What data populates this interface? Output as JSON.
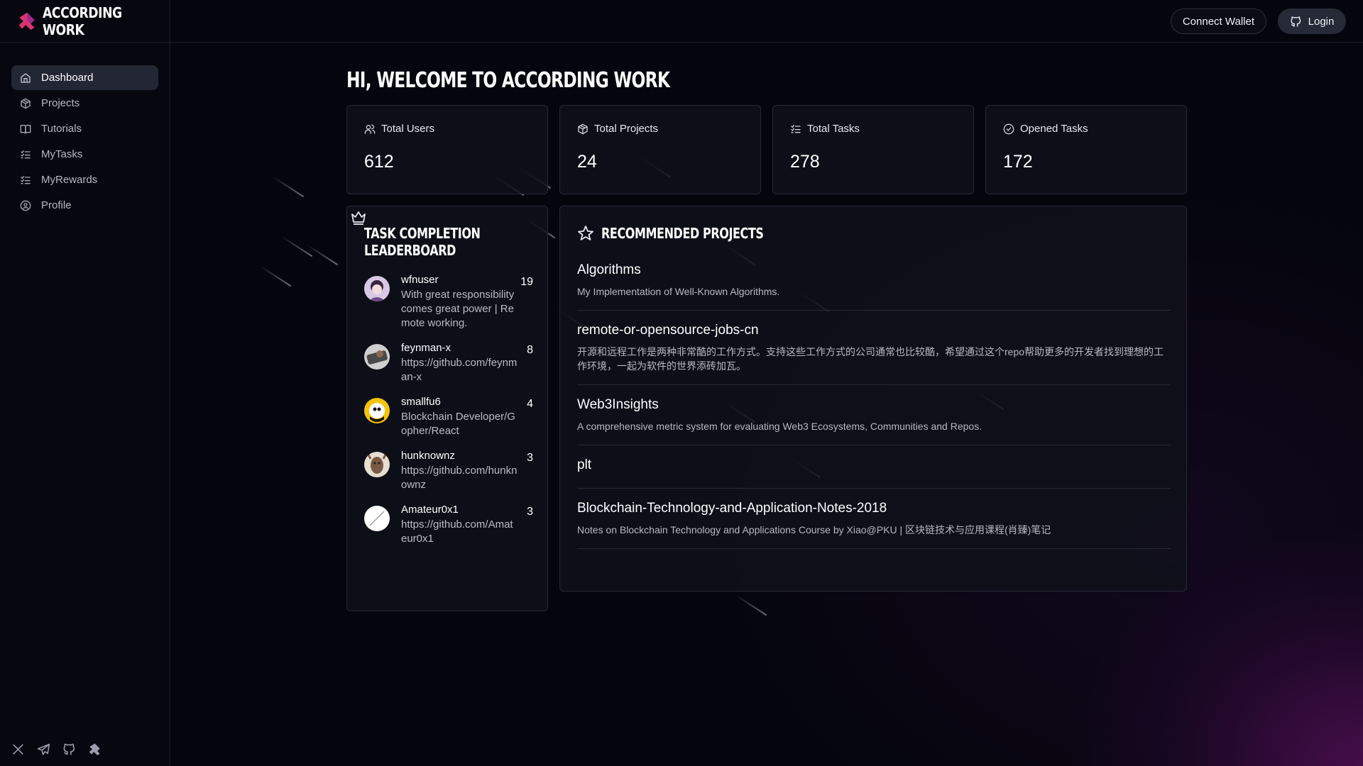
{
  "brand": {
    "name": "According Work"
  },
  "sidebar": {
    "items": [
      {
        "label": "Dashboard",
        "icon": "home-icon",
        "active": true
      },
      {
        "label": "Projects",
        "icon": "package-icon"
      },
      {
        "label": "Tutorials",
        "icon": "book-icon"
      },
      {
        "label": "MyTasks",
        "icon": "list-checks-icon"
      },
      {
        "label": "MyRewards",
        "icon": "list-checks-icon"
      },
      {
        "label": "Profile",
        "icon": "user-circle-icon"
      }
    ],
    "social": [
      "x-icon",
      "telegram-icon",
      "github-icon",
      "according-work-icon"
    ]
  },
  "header": {
    "connect_wallet": "Connect Wallet",
    "login": "Login"
  },
  "welcome": "Hi, Welcome to According Work",
  "stats": [
    {
      "label": "Total Users",
      "value": "612",
      "icon": "users-icon"
    },
    {
      "label": "Total Projects",
      "value": "24",
      "icon": "package-icon"
    },
    {
      "label": "Total Tasks",
      "value": "278",
      "icon": "list-checks-icon"
    },
    {
      "label": "Opened Tasks",
      "value": "172",
      "icon": "check-circle-icon"
    }
  ],
  "leaderboard": {
    "title": "Task Completion Leaderboard",
    "users": [
      {
        "name": "wfnuser",
        "bio": "With great responsibility comes great power | Remote working.",
        "score": "19"
      },
      {
        "name": "feynman-x",
        "bio": "https://github.com/feynman-x",
        "score": "8"
      },
      {
        "name": "smallfu6",
        "bio": "Blockchain Developer/Gopher/React",
        "score": "4"
      },
      {
        "name": "hunknownz",
        "bio": "https://github.com/hunknownz",
        "score": "3"
      },
      {
        "name": "Amateur0x1",
        "bio": "https://github.com/Amateur0x1",
        "score": "3"
      }
    ]
  },
  "recommended": {
    "title": "Recommended Projects",
    "projects": [
      {
        "name": "Algorithms",
        "desc": "My Implementation of Well-Known Algorithms."
      },
      {
        "name": "remote-or-opensource-jobs-cn",
        "desc": "开源和远程工作是两种非常酷的工作方式。支持这些工作方式的公司通常也比较酷，希望通过这个repo帮助更多的开发者找到理想的工作环境，一起为软件的世界添砖加瓦。"
      },
      {
        "name": "Web3Insights",
        "desc": "A comprehensive metric system for evaluating Web3 Ecosystems, Communities and Repos."
      },
      {
        "name": "plt",
        "desc": ""
      },
      {
        "name": "Blockchain-Technology-and-Application-Notes-2018",
        "desc": "Notes on Blockchain Technology and Applications Course by Xiao@PKU | 区块链技术与应用课程(肖臻)笔记"
      }
    ]
  }
}
